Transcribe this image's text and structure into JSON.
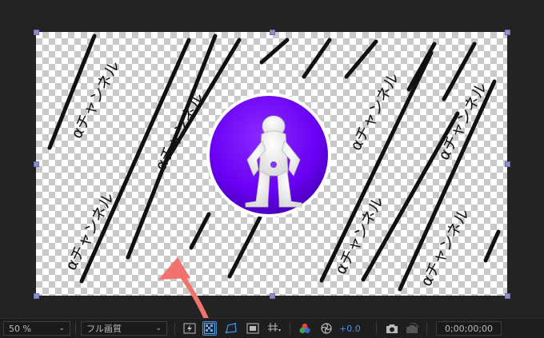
{
  "viewer": {
    "watermark_text": "αチャンネル",
    "logo": "purple circle emblem with white standing figure (logo)"
  },
  "toolbar": {
    "zoom": "50 %",
    "resolution": "フル画質",
    "exposure": "+0.0",
    "timecode": "0;00;00;00"
  },
  "icons": {
    "fast_previews": "lightning-preview-icon",
    "transparency_grid": "transparency-grid-icon",
    "mask_path": "mask-path-icon",
    "region_of_interest": "region-of-interest-icon",
    "grid_guides": "grid-guides-icon",
    "channels": "rgb-channels-icon",
    "color_management": "color-management-icon",
    "snapshot": "camera-icon",
    "show_snapshot": "show-snapshot-icon"
  },
  "colors": {
    "accent": "#4b8cd6",
    "logo_purple": "#6a00f4",
    "arrow": "#f0736e"
  }
}
